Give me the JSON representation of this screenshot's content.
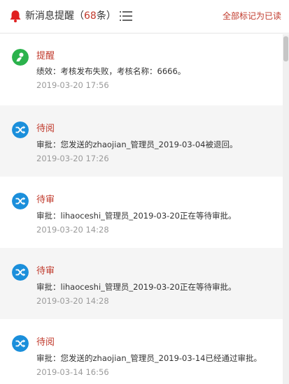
{
  "header": {
    "title_prefix": "新消息提醒（",
    "count": "68",
    "title_suffix": "条）",
    "mark_all_read": "全部标记为已读",
    "bell_icon": "bell-icon",
    "menu_icon": "list-menu-icon"
  },
  "colors": {
    "accent_red": "#c0392b",
    "icon_green": "#2bb24c",
    "icon_blue": "#1b8fdb",
    "muted_text": "#9a9a9a",
    "shaded_row": "#f5f5f5"
  },
  "messages": [
    {
      "icon": "user-icon",
      "type": "提醒",
      "text": "绩效：考核发布失败，考核名称：6666。",
      "time": "2019-03-20 17:56"
    },
    {
      "icon": "shuffle-icon",
      "type": "待阅",
      "text": "审批：您发送的zhaojian_管理员_2019-03-04被退回。",
      "time": "2019-03-20 17:26"
    },
    {
      "icon": "shuffle-icon",
      "type": "待审",
      "text": "审批：lihaoceshi_管理员_2019-03-20正在等待审批。",
      "time": "2019-03-20 14:28"
    },
    {
      "icon": "shuffle-icon",
      "type": "待审",
      "text": "审批：lihaoceshi_管理员_2019-03-20正在等待审批。",
      "time": "2019-03-20 14:28"
    },
    {
      "icon": "shuffle-icon",
      "type": "待阅",
      "text": "审批：您发送的zhaojian_管理员_2019-03-14已经通过审批。",
      "time": "2019-03-14 16:56"
    }
  ]
}
